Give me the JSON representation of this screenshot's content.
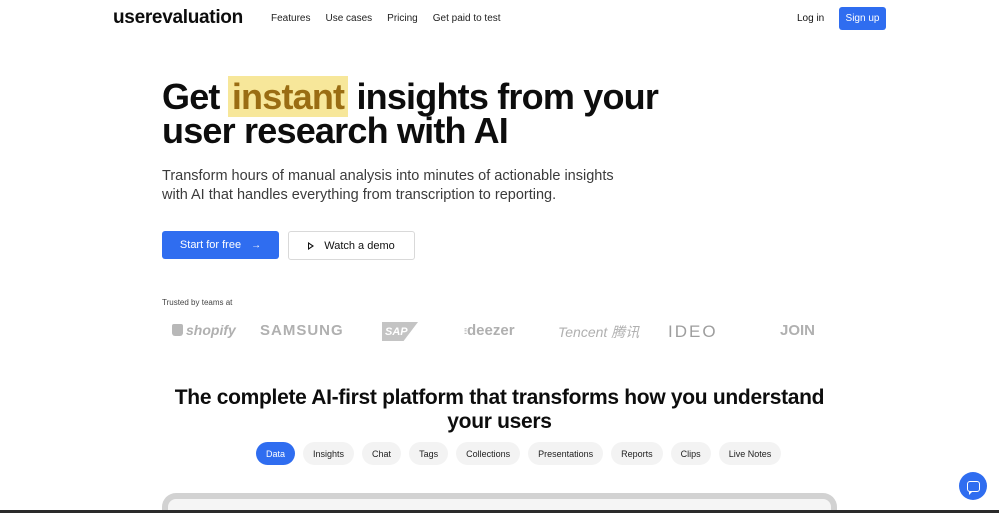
{
  "nav": {
    "logo": "userevaluation",
    "links": [
      "Features",
      "Use cases",
      "Pricing",
      "Get paid to test"
    ],
    "login": "Log in",
    "signup": "Sign up"
  },
  "hero": {
    "title_pre": "Get",
    "title_highlight": "instant",
    "title_post": "insights from your",
    "title_line2": "user research with AI",
    "subtitle": "Transform hours of manual analysis into minutes of actionable insights with AI that handles everything from transcription to reporting.",
    "cta_primary": "Start for free",
    "cta_primary_icon": "arrow-right-icon",
    "cta_secondary": "Watch a demo",
    "cta_secondary_icon": "play-icon"
  },
  "trusted": {
    "label": "Trusted by teams at",
    "logos": [
      "shopify",
      "SAMSUNG",
      "SAP",
      "deezer",
      "Tencent 腾讯",
      "IDEO",
      "JOIN"
    ]
  },
  "platform": {
    "title_line1": "The complete AI-first platform that transforms how you understand",
    "title_line2": "your users",
    "tabs": [
      "Data",
      "Insights",
      "Chat",
      "Tags",
      "Collections",
      "Presentations",
      "Reports",
      "Clips",
      "Live Notes"
    ],
    "active_tab": "Data"
  },
  "colors": {
    "accent": "#2f6df0",
    "highlight_bg": "#f7e79a",
    "highlight_text": "#9a6d13"
  },
  "chat_widget_icon": "chat-bubble-icon"
}
